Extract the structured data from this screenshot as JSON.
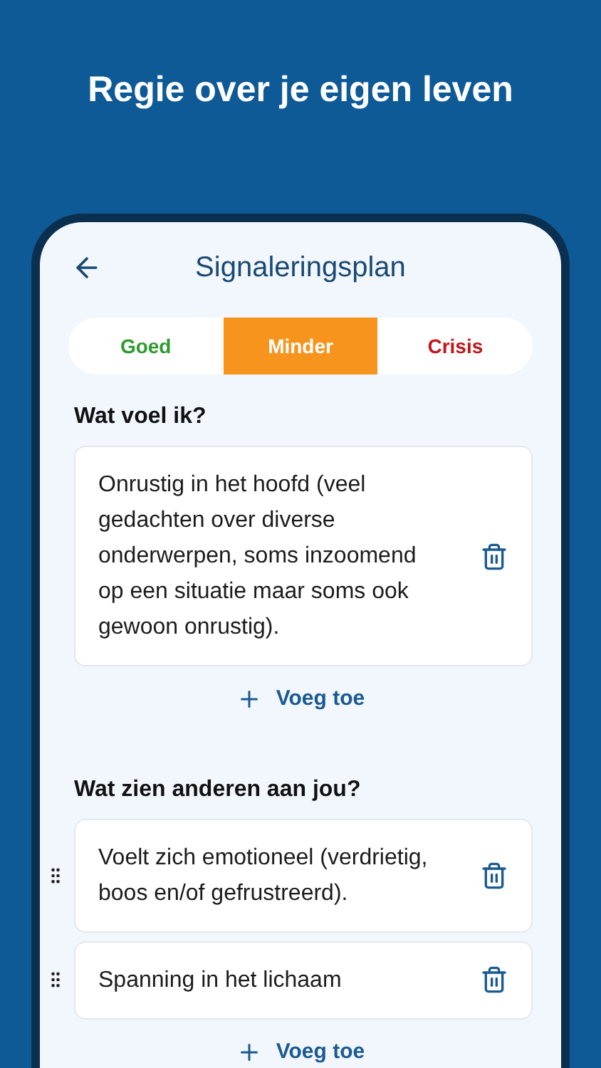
{
  "headline": "Regie over je eigen leven",
  "app_bar": {
    "title": "Signaleringsplan"
  },
  "tabs": [
    {
      "label": "Goed",
      "selected": false,
      "color": "#2e9a2e"
    },
    {
      "label": "Minder",
      "selected": true,
      "color": "#f7941d"
    },
    {
      "label": "Crisis",
      "selected": false,
      "color": "#c3161c"
    }
  ],
  "sections": [
    {
      "title": "Wat voel ik?",
      "items": [
        {
          "text": "Onrustig in het hoofd (veel gedachten over diverse onderwerpen, soms inzoomend op een situatie maar soms ook gewoon onrustig).",
          "draggable": false
        }
      ],
      "add_label": "Voeg toe"
    },
    {
      "title": "Wat zien anderen aan jou?",
      "items": [
        {
          "text": "Voelt zich emotioneel (verdrietig, boos en/of gefrustreerd).",
          "draggable": true
        },
        {
          "text": "Spanning in het lichaam",
          "draggable": true
        }
      ],
      "add_label": "Voeg toe"
    }
  ]
}
